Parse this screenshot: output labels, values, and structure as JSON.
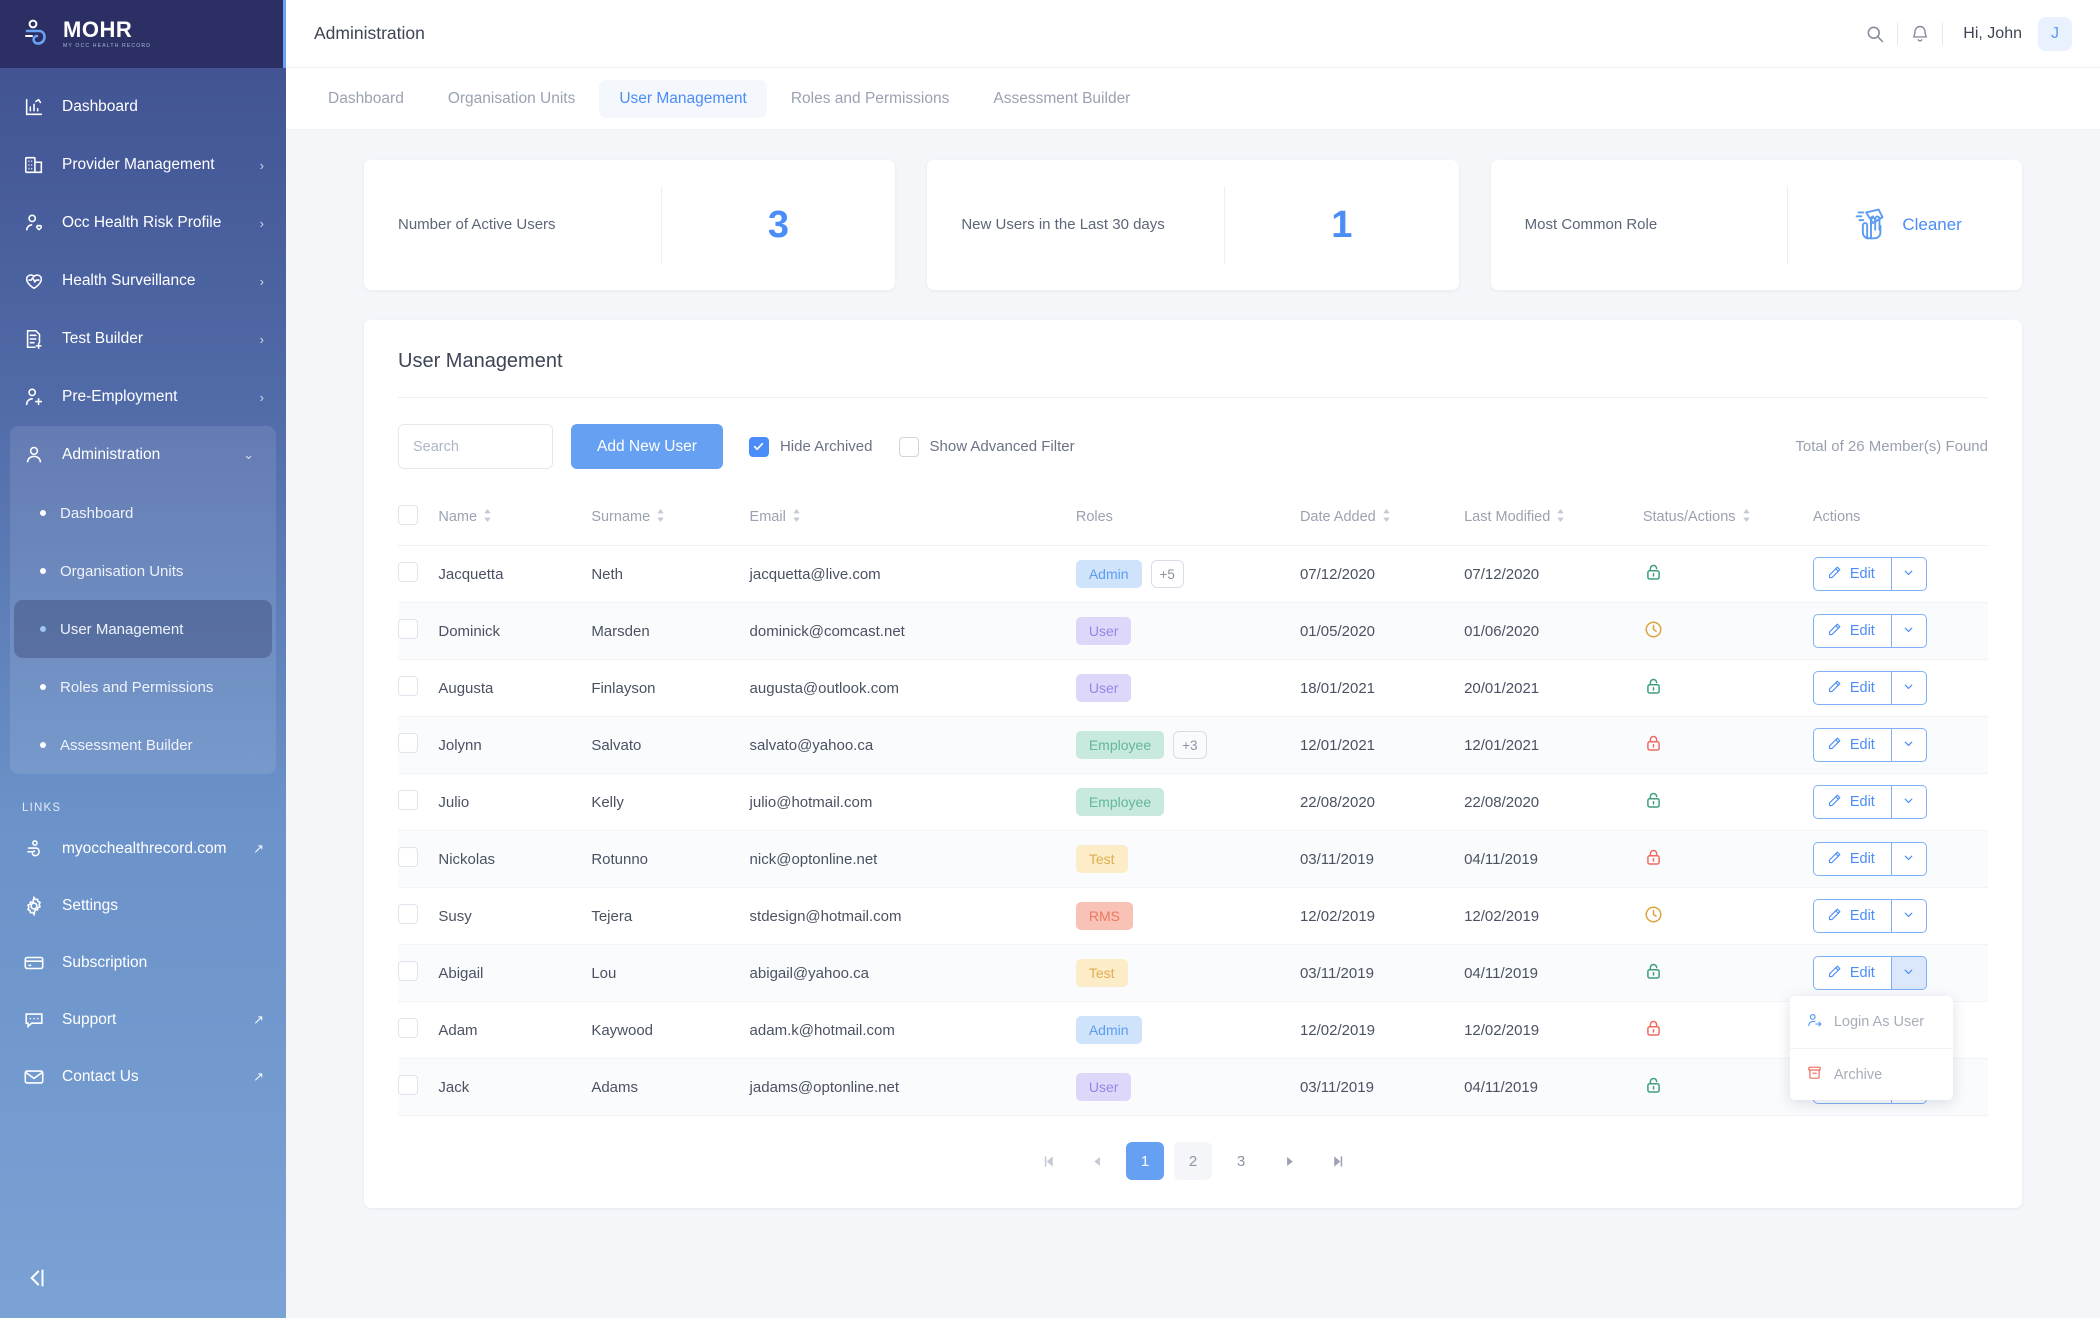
{
  "brand": {
    "name": "MOHR",
    "tagline": "MY OCC HEALTH RECORD",
    "logo_icon": "mohr-logo-icon"
  },
  "sidebar": {
    "items": [
      {
        "label": "Dashboard",
        "icon": "chart-bar-icon",
        "expandable": false
      },
      {
        "label": "Provider Management",
        "icon": "building-icon",
        "expandable": true
      },
      {
        "label": "Occ Health Risk Profile",
        "icon": "user-heart-icon",
        "expandable": true
      },
      {
        "label": "Health Surveillance",
        "icon": "heart-pulse-icon",
        "expandable": true
      },
      {
        "label": "Test Builder",
        "icon": "document-plus-icon",
        "expandable": true
      },
      {
        "label": "Pre-Employment",
        "icon": "user-plus-icon",
        "expandable": true
      }
    ],
    "group": {
      "label": "Administration",
      "icon": "user-icon",
      "expanded": true,
      "sub_items": [
        {
          "label": "Dashboard",
          "active": false
        },
        {
          "label": "Organisation Units",
          "active": false
        },
        {
          "label": "User Management",
          "active": true
        },
        {
          "label": "Roles and Permissions",
          "active": false
        },
        {
          "label": "Assessment Builder",
          "active": false
        }
      ]
    },
    "links_header": "LINKS",
    "links": [
      {
        "label": "myocchealthrecord.com",
        "icon": "mohr-mark-icon",
        "external": true
      },
      {
        "label": "Settings",
        "icon": "gear-icon",
        "external": false
      },
      {
        "label": "Subscription",
        "icon": "credit-card-icon",
        "external": false
      },
      {
        "label": "Support",
        "icon": "chat-icon",
        "external": true
      },
      {
        "label": "Contact Us",
        "icon": "envelope-icon",
        "external": true
      }
    ],
    "collapse_icon": "collapse-sidebar-icon"
  },
  "topbar": {
    "title": "Administration",
    "search_icon": "search-icon",
    "bell_icon": "notification-bell-icon",
    "greeting": "Hi, John",
    "avatar_initial": "J"
  },
  "tabs": [
    {
      "label": "Dashboard",
      "active": false
    },
    {
      "label": "Organisation Units",
      "active": false
    },
    {
      "label": "User Management",
      "active": true
    },
    {
      "label": "Roles and Permissions",
      "active": false
    },
    {
      "label": "Assessment Builder",
      "active": false
    }
  ],
  "stats": [
    {
      "label": "Number of Active Users",
      "value": "3",
      "type": "number"
    },
    {
      "label": "New Users in the Last 30 days",
      "value": "1",
      "type": "number"
    },
    {
      "label": "Most Common Role",
      "value": "Cleaner",
      "type": "role",
      "icon": "cleaner-hand-icon"
    }
  ],
  "panel": {
    "title": "User Management",
    "search_placeholder": "Search",
    "search_value": "",
    "search_icon": "search-icon",
    "add_button": "Add New User",
    "checkboxes": [
      {
        "label": "Hide Archived",
        "checked": true
      },
      {
        "label": "Show Advanced Filter",
        "checked": false
      }
    ],
    "total_text": "Total of 26 Member(s) Found"
  },
  "table": {
    "columns": [
      {
        "label": "",
        "sortable": false,
        "key": "checkbox"
      },
      {
        "label": "Name",
        "sortable": true
      },
      {
        "label": "Surname",
        "sortable": true
      },
      {
        "label": "Email",
        "sortable": true
      },
      {
        "label": "Roles",
        "sortable": false
      },
      {
        "label": "Date Added",
        "sortable": true
      },
      {
        "label": "Last Modified",
        "sortable": true
      },
      {
        "label": "Status/Actions",
        "sortable": true
      },
      {
        "label": "Actions",
        "sortable": false
      }
    ],
    "edit_label": "Edit",
    "rows": [
      {
        "name": "Jacquetta",
        "surname": "Neth",
        "email": "jacquetta@live.com",
        "role": "Admin",
        "role_class": "b-admin",
        "extra": "+5",
        "date_added": "07/12/2020",
        "last_modified": "07/12/2020",
        "status": "unlocked-green",
        "menu_open": false
      },
      {
        "name": "Dominick",
        "surname": "Marsden",
        "email": "dominick@comcast.net",
        "role": "User",
        "role_class": "b-user",
        "extra": "",
        "date_added": "01/05/2020",
        "last_modified": "01/06/2020",
        "status": "pending-clock",
        "menu_open": false
      },
      {
        "name": "Augusta",
        "surname": "Finlayson",
        "email": "augusta@outlook.com",
        "role": "User",
        "role_class": "b-user",
        "extra": "",
        "date_added": "18/01/2021",
        "last_modified": "20/01/2021",
        "status": "unlocked-green",
        "menu_open": false
      },
      {
        "name": "Jolynn",
        "surname": "Salvato",
        "email": "salvato@yahoo.ca",
        "role": "Employee",
        "role_class": "b-emp",
        "extra": "+3",
        "date_added": "12/01/2021",
        "last_modified": "12/01/2021",
        "status": "locked-red",
        "menu_open": false
      },
      {
        "name": "Julio",
        "surname": "Kelly",
        "email": "julio@hotmail.com",
        "role": "Employee",
        "role_class": "b-emp",
        "extra": "",
        "date_added": "22/08/2020",
        "last_modified": "22/08/2020",
        "status": "unlocked-green",
        "menu_open": false
      },
      {
        "name": "Nickolas",
        "surname": "Rotunno",
        "email": "nick@optonline.net",
        "role": "Test",
        "role_class": "b-test",
        "extra": "",
        "date_added": "03/11/2019",
        "last_modified": "04/11/2019",
        "status": "locked-red",
        "menu_open": false
      },
      {
        "name": "Susy",
        "surname": "Tejera",
        "email": "stdesign@hotmail.com",
        "role": "RMS",
        "role_class": "b-rms",
        "extra": "",
        "date_added": "12/02/2019",
        "last_modified": "12/02/2019",
        "status": "pending-clock",
        "menu_open": false
      },
      {
        "name": "Abigail",
        "surname": "Lou",
        "email": "abigail@yahoo.ca",
        "role": "Test",
        "role_class": "b-test",
        "extra": "",
        "date_added": "03/11/2019",
        "last_modified": "04/11/2019",
        "status": "unlocked-green",
        "menu_open": true
      },
      {
        "name": "Adam",
        "surname": "Kaywood",
        "email": "adam.k@hotmail.com",
        "role": "Admin",
        "role_class": "b-admin",
        "extra": "",
        "date_added": "12/02/2019",
        "last_modified": "12/02/2019",
        "status": "locked-red",
        "menu_open": false
      },
      {
        "name": "Jack",
        "surname": "Adams",
        "email": "jadams@optonline.net",
        "role": "User",
        "role_class": "b-user",
        "extra": "",
        "date_added": "03/11/2019",
        "last_modified": "04/11/2019",
        "status": "unlocked-green",
        "menu_open": false
      }
    ]
  },
  "row_menu": {
    "items": [
      {
        "label": "Login As User",
        "icon": "login-as-user-icon"
      },
      {
        "label": "Archive",
        "icon": "archive-icon"
      }
    ]
  },
  "pagination": {
    "first_icon": "first-page-icon",
    "prev_icon": "prev-page-icon",
    "pages": [
      {
        "label": "1",
        "current": true
      },
      {
        "label": "2",
        "current": false
      },
      {
        "label": "3",
        "current": false
      }
    ],
    "next_icon": "next-page-icon",
    "last_icon": "last-page-icon"
  },
  "colors": {
    "accent": "#4b8df8",
    "primary_button": "#65a0f2",
    "sidebar_top": "#2b2f63",
    "status_green": "#3f9e7e",
    "status_red": "#ef6b62",
    "status_amber": "#d9a43b"
  }
}
